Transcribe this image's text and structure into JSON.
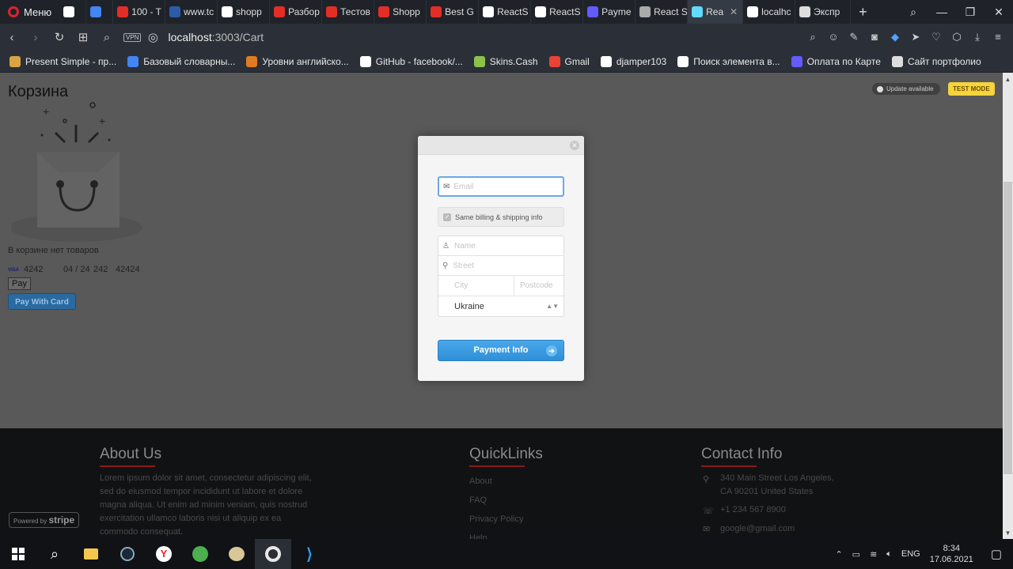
{
  "browser": {
    "menu_label": "Меню",
    "tabs": [
      {
        "label": "",
        "color": "#ffffff"
      },
      {
        "label": "",
        "color": "#4285f4"
      },
      {
        "label": "100 - T",
        "color": "#e52d27"
      },
      {
        "label": "www.tc",
        "color": "#2a5caa"
      },
      {
        "label": "shopp",
        "color": "#ffffff"
      },
      {
        "label": "Разбор",
        "color": "#e52d27"
      },
      {
        "label": "Тестов",
        "color": "#e52d27"
      },
      {
        "label": "Shopp",
        "color": "#e52d27"
      },
      {
        "label": "Best G",
        "color": "#e52d27"
      },
      {
        "label": "ReactS",
        "color": "#ffffff"
      },
      {
        "label": "ReactS",
        "color": "#ffffff"
      },
      {
        "label": "Payme",
        "color": "#635bff"
      },
      {
        "label": "React S",
        "color": "#aaaaaa"
      },
      {
        "label": "Rea",
        "color": "#61dafb",
        "active": true
      },
      {
        "label": "localhc",
        "color": "#ffffff"
      },
      {
        "label": "Экспр",
        "color": "#dddddd"
      }
    ],
    "url_host": "localhost",
    "url_path": ":3003/Cart",
    "vpn_label": "VPN",
    "bookmarks": [
      {
        "label": "Present Simple - пр...",
        "color": "#d9a441"
      },
      {
        "label": "Базовый словарны...",
        "color": "#4285f4"
      },
      {
        "label": "Уровни английско...",
        "color": "#e07b22"
      },
      {
        "label": "GitHub - facebook/...",
        "color": "#ffffff"
      },
      {
        "label": "Skins.Cash",
        "color": "#8bc34a"
      },
      {
        "label": "Gmail",
        "color": "#ea4335"
      },
      {
        "label": "djamper103",
        "color": "#ffffff"
      },
      {
        "label": "Поиск элемента в...",
        "color": "#ffffff"
      },
      {
        "label": "Оплата по Карте",
        "color": "#635bff"
      },
      {
        "label": "Сайт портфолио",
        "color": "#dddddd"
      }
    ]
  },
  "page": {
    "title": "Корзина",
    "empty_text": "В корзине нет товаров",
    "card": {
      "brand": "VISA",
      "number": "4242",
      "expiry": "04 / 24",
      "cvc": "242",
      "zip": "42424"
    },
    "pay_label": "Pay",
    "pay_card_label": "Pay With Card",
    "update_label": "Update available",
    "test_mode_label": "TEST MODE"
  },
  "modal": {
    "email_placeholder": "Email",
    "same_billing_label": "Same billing & shipping info",
    "name_placeholder": "Name",
    "street_placeholder": "Street",
    "city_placeholder": "City",
    "postcode_placeholder": "Postcode",
    "country_value": "Ukraine",
    "payment_button": "Payment Info"
  },
  "footer": {
    "about_title": "About Us",
    "about_text": "Lorem ipsum dolor sit amet, consectetur adipiscing elit, sed do eiusmod tempor incididunt ut labore et dolore magna aliqua. Ut enim ad minim veniam, quis nostrud exercitation ullamco laboris nisi ut aliquip ex ea commodo consequat.",
    "links_title": "QuickLinks",
    "links": [
      "About",
      "FAQ",
      "Privacy Policy",
      "Help"
    ],
    "contact_title": "Contact Info",
    "address_line1": "340 Main Street Los Angeles,",
    "address_line2": "CA 90201 United States",
    "phone": "+1 234 567 8900",
    "email": "google@gmail.com",
    "stripe_powered": "Powered by",
    "stripe_brand": "stripe"
  },
  "taskbar": {
    "language": "ENG",
    "time": "8:34",
    "date": "17.06.2021"
  }
}
